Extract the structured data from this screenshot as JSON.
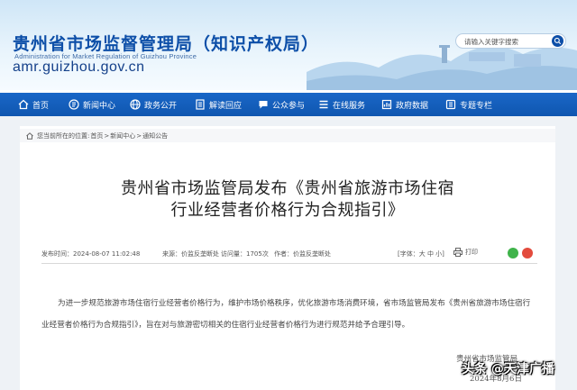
{
  "header": {
    "title": "贵州省市场监督管理局（知识产权局）",
    "subtitle": "Administration for Market Regulation of Guizhou Province",
    "url": "amr.guizhou.gov.cn",
    "search_placeholder": "请输入关键字搜索"
  },
  "nav": {
    "items": [
      {
        "label": "首页",
        "icon": "home-icon"
      },
      {
        "label": "新闻中心",
        "icon": "news-icon"
      },
      {
        "label": "政务公开",
        "icon": "globe-icon"
      },
      {
        "label": "解读回应",
        "icon": "doc-icon"
      },
      {
        "label": "公众参与",
        "icon": "chat-icon"
      },
      {
        "label": "在线服务",
        "icon": "list-icon"
      },
      {
        "label": "政府数据",
        "icon": "data-icon"
      },
      {
        "label": "专题专栏",
        "icon": "folder-icon"
      }
    ]
  },
  "breadcrumb": {
    "prefix": "您当前所在的位置:",
    "items": [
      "首页",
      "新闻中心",
      "通知公告"
    ],
    "separator": ">"
  },
  "article": {
    "title_line1": "贵州省市场监管局发布《贵州省旅游市场住宿",
    "title_line2": "行业经营者价格行为合规指引》",
    "meta_date": "发布时间：2024-08-07 11:02:48",
    "meta_source": "来源：价监反垄断处",
    "meta_views": "访问量：1705次",
    "meta_author": "作者：价监反垄断处",
    "font_size_label": "[字体：大 中 小]",
    "print_label": "打印",
    "paragraph": "为进一步规范旅游市场住宿行业经营者价格行为，维护市场价格秩序，优化旅游市场消费环境，省市场监管局发布《贵州省旅游市场住宿行业经营者价格行为合规指引》，旨在对与旅游密切相关的住宿行业经营者价格行为进行规范并给予合理引导。",
    "signature": "贵州省市场监管局",
    "sign_date": "2024年8月6日"
  },
  "watermark": "头条 @天津广播",
  "colors": {
    "brand_blue": "#0d4fa8",
    "nav_blue": "#1261bd",
    "wechat_green": "#3fb34a",
    "weibo_red": "#e34b3d"
  }
}
